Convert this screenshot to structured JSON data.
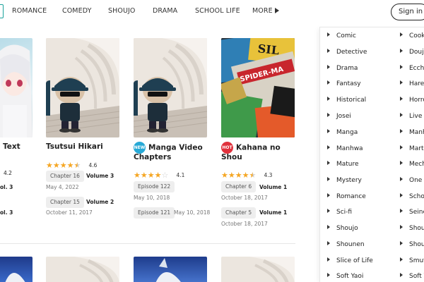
{
  "nav": {
    "items": [
      "ROMANCE",
      "COMEDY",
      "SHOUJO",
      "DRAMA",
      "SCHOOL LIFE",
      "MORE"
    ],
    "signin": "Sign in"
  },
  "cards": {
    "c0": {
      "title_partial": "Text",
      "rating_partial": "4.2",
      "line1_partial": "ol. 3",
      "line2_partial": "ol. 3"
    },
    "c1": {
      "title": "Tsutsui Hikari",
      "rating": "4.6",
      "stars": 4.5,
      "chapters": [
        {
          "chip": "Chapter 16",
          "volume": "Volume 3",
          "date": "May 4, 2022"
        },
        {
          "chip": "Chapter 15",
          "volume": "Volume 2",
          "date": "October 11, 2017"
        }
      ]
    },
    "c2": {
      "badge": "NEW",
      "title_line1": "Manga Video",
      "title_line2": "Chapters",
      "rating": "4.1",
      "stars": 4,
      "chapters": [
        {
          "chip": "Episode 122",
          "date": "May 10, 2018"
        },
        {
          "chip": "Episode 121",
          "date": "May 10, 2018"
        }
      ]
    },
    "c3": {
      "badge": "HOT",
      "title_line1": "Kahana no",
      "title_line2": "Shou",
      "rating": "4.3",
      "stars": 4.5,
      "chapters": [
        {
          "chip": "Chapter 6",
          "volume": "Volume 1",
          "date": "October 18, 2017"
        },
        {
          "chip": "Chapter 5",
          "volume": "Volume 1",
          "date": "October 18, 2017"
        }
      ]
    }
  },
  "sidebar": {
    "col1": [
      "Comic",
      "Detective",
      "Drama",
      "Fantasy",
      "Historical",
      "Josei",
      "Manga",
      "Manhwa",
      "Mature",
      "Mystery",
      "Romance",
      "Sci-fi",
      "Shoujo",
      "Shounen",
      "Slice of Life",
      "Soft Yaoi"
    ],
    "col2": [
      "Cook",
      "Douji",
      "Ecch",
      "Hare",
      "Horro",
      "Live a",
      "Manh",
      "Marti",
      "Mech",
      "One s",
      "Scho",
      "Seine",
      "Shou",
      "Shou",
      "Smut",
      "Soft Y"
    ]
  },
  "colors": {
    "accent": "#1ba39c",
    "star": "#f5a623",
    "badge_new": "#27a9d6",
    "badge_hot": "#e0313c"
  }
}
